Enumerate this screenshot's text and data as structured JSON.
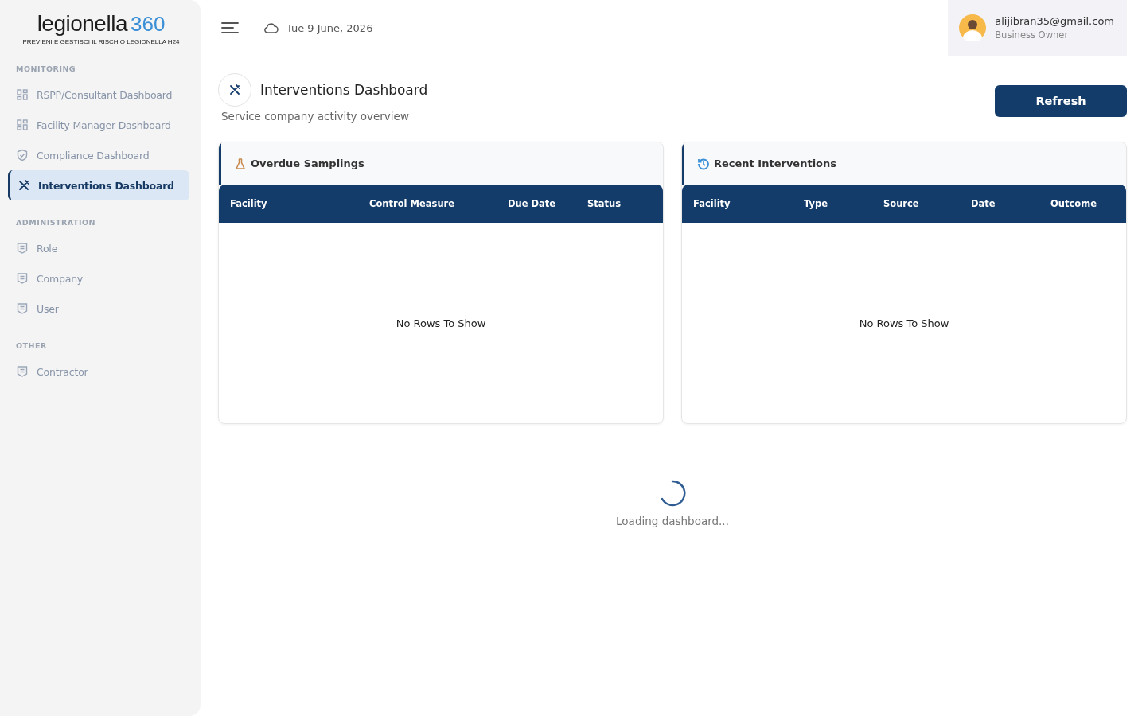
{
  "logo": {
    "name": "legionella",
    "number": "360",
    "tagline": "PREVIENI E GESTISCI IL RISCHIO LEGIONELLA H24"
  },
  "sidebar": {
    "sections": [
      {
        "title": "MONITORING",
        "items": [
          {
            "label": "RSPP/Consultant Dashboard",
            "kind": "grid",
            "selected": false
          },
          {
            "label": "Facility Manager Dashboard",
            "kind": "grid",
            "selected": false
          },
          {
            "label": "Compliance Dashboard",
            "kind": "shield",
            "selected": false
          },
          {
            "label": "Interventions Dashboard",
            "kind": "tools",
            "selected": true
          }
        ]
      },
      {
        "title": "ADMINISTRATION",
        "items": [
          {
            "label": "Role",
            "kind": "doc",
            "selected": false
          },
          {
            "label": "Company",
            "kind": "doc",
            "selected": false
          },
          {
            "label": "User",
            "kind": "doc",
            "selected": false
          }
        ]
      },
      {
        "title": "OTHER",
        "items": [
          {
            "label": "Contractor",
            "kind": "doc",
            "selected": false
          }
        ]
      }
    ]
  },
  "topbar": {
    "date": "Tue 9 June, 2026",
    "user": {
      "email": "alijibran35@gmail.com",
      "role": "Business Owner"
    }
  },
  "page": {
    "title": "Interventions Dashboard",
    "subtitle": "Service company activity overview",
    "refresh_button": "Refresh"
  },
  "panels": [
    {
      "title": "Overdue Samplings",
      "kind": "flask",
      "columns": [
        "Facility",
        "Control Measure",
        "Due Date",
        "Status"
      ],
      "empty_text": "No Rows To Show"
    },
    {
      "title": "Recent Interventions",
      "kind": "history",
      "columns": [
        "Facility",
        "Type",
        "Source",
        "Date",
        "Outcome"
      ],
      "empty_text": "No Rows To Show"
    }
  ],
  "loading": {
    "text": "Loading dashboard..."
  }
}
